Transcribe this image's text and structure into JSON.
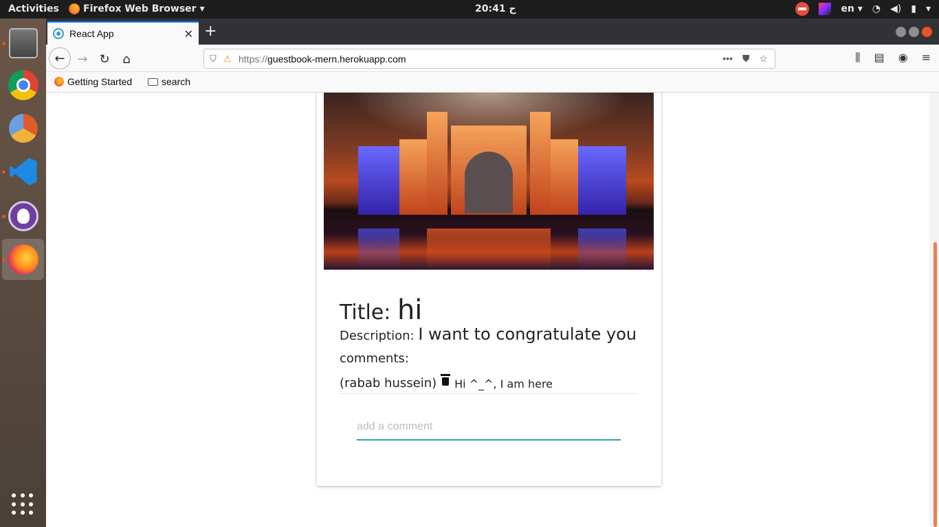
{
  "topbar": {
    "activities": "Activities",
    "app_menu": "Firefox Web Browser",
    "clock": "20:41 ح",
    "lang": "en"
  },
  "dock": {
    "items": [
      {
        "name": "files-icon"
      },
      {
        "name": "chrome-icon"
      },
      {
        "name": "chromium-icon"
      },
      {
        "name": "vscode-icon"
      },
      {
        "name": "github-desktop-icon"
      },
      {
        "name": "firefox-icon"
      }
    ]
  },
  "browser": {
    "tab_title": "React App",
    "tab_close": "✕",
    "new_tab": "+",
    "url_prefix": "https://",
    "url_host": "guestbook-mern.herokuapp.com",
    "bookmarks": [
      {
        "label": "Getting Started"
      },
      {
        "label": "search"
      }
    ]
  },
  "card": {
    "title_label": "Title:",
    "title_value": "hi",
    "description_label": "Description:",
    "description_value": "I want to congratulate you",
    "comments_label": "comments:",
    "comments": [
      {
        "author": "(rabab hussein)",
        "text": "Hi ^_^, I am here"
      }
    ],
    "comment_placeholder": "add a comment"
  },
  "colors": {
    "input_underline": "#26a69a",
    "tab_accent": "#0a84ff",
    "ubuntu_orange": "#e95420"
  }
}
